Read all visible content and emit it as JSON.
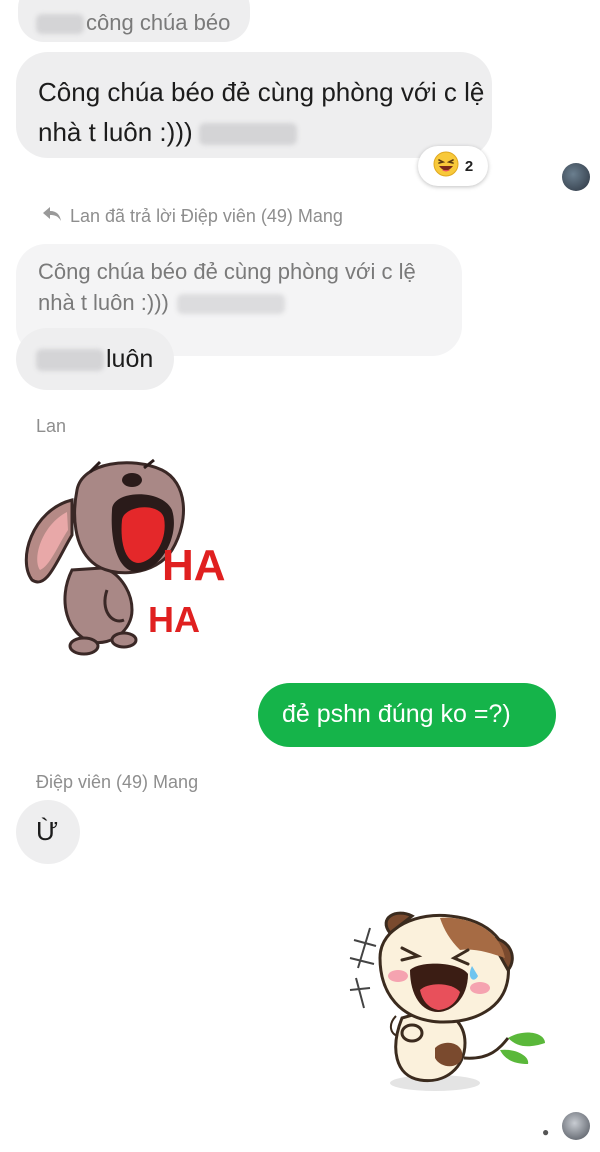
{
  "conversation": {
    "top_partial_message": {
      "visible_text": "công chúa béo"
    },
    "message_1": {
      "text": "Công chúa béo đẻ cùng phòng với c lệ nhà t luôn :)))"
    },
    "reaction": {
      "emoji": "😆",
      "count": "2",
      "icon": "laughing-emoji-icon"
    },
    "reply_header": {
      "icon": "reply-arrow-icon",
      "text": "Lan đã trả lời Điệp viên (49) Mang"
    },
    "quoted_message": {
      "text": "Công chúa béo đẻ cùng phòng với c lệ nhà t luôn :)))"
    },
    "message_2": {
      "text": "luôn"
    },
    "sender_lan": "Lan",
    "sticker_1": {
      "text_1": "HA",
      "text_2": "HA",
      "icon": "laughing-dog-sticker"
    },
    "my_message": {
      "text": "đẻ pshn đúng ko =?)"
    },
    "sender_diep": "Điệp viên (49) Mang",
    "message_3": {
      "text": "Ừ"
    },
    "sticker_2": {
      "icon": "laughing-puppy-sticker"
    }
  },
  "colors": {
    "my_bubble": "#15b44a",
    "other_bubble": "#eeeeef",
    "meta_text": "#8e8e8e"
  }
}
